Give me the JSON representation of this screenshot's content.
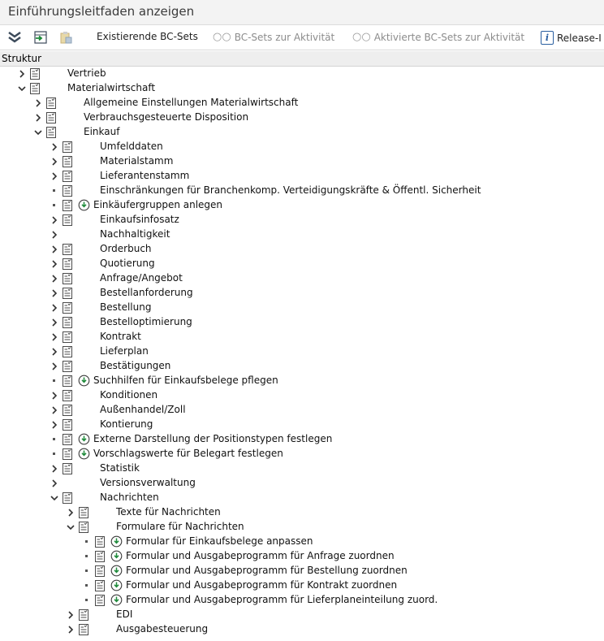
{
  "window": {
    "title": "Einführungsleitfaden anzeigen"
  },
  "toolbar": {
    "btn_existing": "Existierende BC-Sets",
    "btn_activity": "BC-Sets zur Aktivität",
    "btn_activated": "Aktivierte BC-Sets zur Aktivität",
    "btn_release": "Release-I"
  },
  "header": {
    "label": "Struktur"
  },
  "tree": [
    {
      "label": "Vertrieb",
      "level": 0,
      "toggle": "collapsed",
      "exec": false
    },
    {
      "label": "Materialwirtschaft",
      "level": 0,
      "toggle": "expanded",
      "exec": false
    },
    {
      "label": "Allgemeine Einstellungen Materialwirtschaft",
      "level": 1,
      "toggle": "collapsed",
      "exec": false
    },
    {
      "label": "Verbrauchsgesteuerte Disposition",
      "level": 1,
      "toggle": "collapsed",
      "exec": false
    },
    {
      "label": "Einkauf",
      "level": 1,
      "toggle": "expanded",
      "exec": false
    },
    {
      "label": "Umfelddaten",
      "level": 2,
      "toggle": "collapsed",
      "exec": false
    },
    {
      "label": "Materialstamm",
      "level": 2,
      "toggle": "collapsed",
      "exec": false
    },
    {
      "label": "Lieferantenstamm",
      "level": 2,
      "toggle": "collapsed",
      "exec": false
    },
    {
      "label": "Einschränkungen für Branchenkomp. Verteidigungskräfte & Öffentl. Sicherheit",
      "level": 2,
      "toggle": "leaf",
      "exec": false
    },
    {
      "label": "Einkäufergruppen anlegen",
      "level": 2,
      "toggle": "leaf",
      "exec": true
    },
    {
      "label": "Einkaufsinfosatz",
      "level": 2,
      "toggle": "collapsed",
      "exec": false
    },
    {
      "label": "Nachhaltigkeit",
      "level": 2,
      "toggle": "collapsed",
      "exec": false,
      "noicon": true
    },
    {
      "label": "Orderbuch",
      "level": 2,
      "toggle": "collapsed",
      "exec": false
    },
    {
      "label": "Quotierung",
      "level": 2,
      "toggle": "collapsed",
      "exec": false
    },
    {
      "label": "Anfrage/Angebot",
      "level": 2,
      "toggle": "collapsed",
      "exec": false
    },
    {
      "label": "Bestellanforderung",
      "level": 2,
      "toggle": "collapsed",
      "exec": false
    },
    {
      "label": "Bestellung",
      "level": 2,
      "toggle": "collapsed",
      "exec": false
    },
    {
      "label": "Bestelloptimierung",
      "level": 2,
      "toggle": "collapsed",
      "exec": false
    },
    {
      "label": "Kontrakt",
      "level": 2,
      "toggle": "collapsed",
      "exec": false
    },
    {
      "label": "Lieferplan",
      "level": 2,
      "toggle": "collapsed",
      "exec": false
    },
    {
      "label": "Bestätigungen",
      "level": 2,
      "toggle": "collapsed",
      "exec": false
    },
    {
      "label": "Suchhilfen für Einkaufsbelege pflegen",
      "level": 2,
      "toggle": "leaf",
      "exec": true
    },
    {
      "label": "Konditionen",
      "level": 2,
      "toggle": "collapsed",
      "exec": false
    },
    {
      "label": "Außenhandel/Zoll",
      "level": 2,
      "toggle": "collapsed",
      "exec": false
    },
    {
      "label": "Kontierung",
      "level": 2,
      "toggle": "collapsed",
      "exec": false
    },
    {
      "label": "Externe Darstellung der Positionstypen festlegen",
      "level": 2,
      "toggle": "leaf",
      "exec": true
    },
    {
      "label": "Vorschlagswerte für Belegart festlegen",
      "level": 2,
      "toggle": "leaf",
      "exec": true
    },
    {
      "label": "Statistik",
      "level": 2,
      "toggle": "collapsed",
      "exec": false
    },
    {
      "label": "Versionsverwaltung",
      "level": 2,
      "toggle": "collapsed",
      "exec": false,
      "noicon": true
    },
    {
      "label": "Nachrichten",
      "level": 2,
      "toggle": "expanded",
      "exec": false
    },
    {
      "label": "Texte für Nachrichten",
      "level": 3,
      "toggle": "collapsed",
      "exec": false
    },
    {
      "label": "Formulare für Nachrichten",
      "level": 3,
      "toggle": "expanded",
      "exec": false
    },
    {
      "label": "Formular für Einkaufsbelege anpassen",
      "level": 4,
      "toggle": "leaf",
      "exec": true
    },
    {
      "label": "Formular und Ausgabeprogramm für Anfrage zuordnen",
      "level": 4,
      "toggle": "leaf",
      "exec": true
    },
    {
      "label": "Formular und Ausgabeprogramm für Bestellung zuordnen",
      "level": 4,
      "toggle": "leaf",
      "exec": true
    },
    {
      "label": "Formular und Ausgabeprogramm für Kontrakt zuordnen",
      "level": 4,
      "toggle": "leaf",
      "exec": true
    },
    {
      "label": "Formular und Ausgabeprogramm für Lieferplaneinteilung zuord.",
      "level": 4,
      "toggle": "leaf",
      "exec": true
    },
    {
      "label": "EDI",
      "level": 3,
      "toggle": "collapsed",
      "exec": false
    },
    {
      "label": "Ausgabesteuerung",
      "level": 3,
      "toggle": "collapsed",
      "exec": false
    }
  ]
}
